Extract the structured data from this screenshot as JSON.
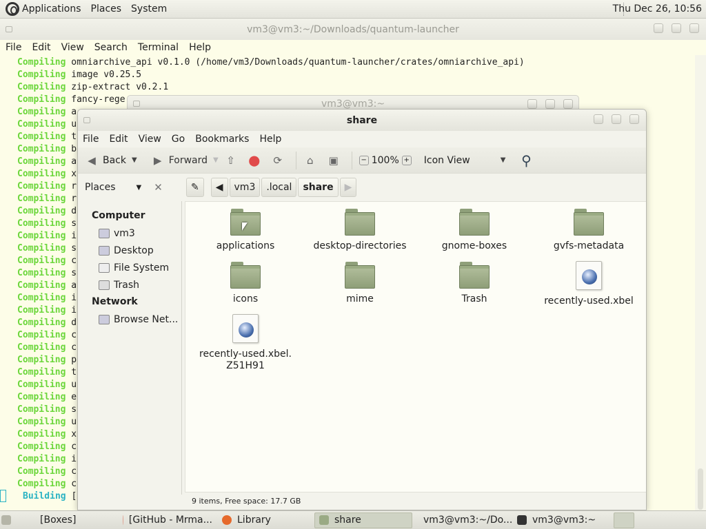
{
  "top_panel": {
    "menus": [
      "Applications",
      "Places",
      "System"
    ],
    "clock": "Thu Dec 26, 10:56"
  },
  "terminal": {
    "title": "vm3@vm3:~/Downloads/quantum-launcher",
    "menus": [
      "File",
      "Edit",
      "View",
      "Search",
      "Terminal",
      "Help"
    ],
    "lines": [
      {
        "kw": "Compiling",
        "text": "omniarchive_api v0.1.0 (/home/vm3/Downloads/quantum-launcher/crates/omniarchive_api)"
      },
      {
        "kw": "Compiling",
        "text": "image v0.25.5"
      },
      {
        "kw": "Compiling",
        "text": "zip-extract v0.2.1"
      },
      {
        "kw": "Compiling",
        "text": "fancy-rege"
      },
      {
        "kw": "Compiling",
        "text": "a"
      },
      {
        "kw": "Compiling",
        "text": "u"
      },
      {
        "kw": "Compiling",
        "text": "t"
      },
      {
        "kw": "Compiling",
        "text": "b"
      },
      {
        "kw": "Compiling",
        "text": "a"
      },
      {
        "kw": "Compiling",
        "text": "x"
      },
      {
        "kw": "Compiling",
        "text": "r"
      },
      {
        "kw": "Compiling",
        "text": "r"
      },
      {
        "kw": "Compiling",
        "text": "d"
      },
      {
        "kw": "Compiling",
        "text": "s"
      },
      {
        "kw": "Compiling",
        "text": "i"
      },
      {
        "kw": "Compiling",
        "text": "s"
      },
      {
        "kw": "Compiling",
        "text": "c"
      },
      {
        "kw": "Compiling",
        "text": "s"
      },
      {
        "kw": "Compiling",
        "text": "a"
      },
      {
        "kw": "Compiling",
        "text": "i"
      },
      {
        "kw": "Compiling",
        "text": "i"
      },
      {
        "kw": "Compiling",
        "text": "d"
      },
      {
        "kw": "Compiling",
        "text": "c"
      },
      {
        "kw": "Compiling",
        "text": "c"
      },
      {
        "kw": "Compiling",
        "text": "p"
      },
      {
        "kw": "Compiling",
        "text": "t"
      },
      {
        "kw": "Compiling",
        "text": "u"
      },
      {
        "kw": "Compiling",
        "text": "e"
      },
      {
        "kw": "Compiling",
        "text": "s"
      },
      {
        "kw": "Compiling",
        "text": "u"
      },
      {
        "kw": "Compiling",
        "text": "x"
      },
      {
        "kw": "Compiling",
        "text": "c"
      },
      {
        "kw": "Compiling",
        "text": "i"
      },
      {
        "kw": "Compiling",
        "text": "c"
      },
      {
        "kw": "Compiling",
        "text": "c"
      }
    ],
    "building": {
      "kw": "Building",
      "text": "["
    }
  },
  "bg_window": {
    "title": "vm3@vm3:~"
  },
  "file_manager": {
    "title": "share",
    "menus": [
      "File",
      "Edit",
      "View",
      "Go",
      "Bookmarks",
      "Help"
    ],
    "toolbar": {
      "back": "Back",
      "forward": "Forward",
      "zoom": "100%",
      "view_mode": "Icon View"
    },
    "sidebar_title": "Places",
    "path": [
      "vm3",
      ".local",
      "share"
    ],
    "sidebar": {
      "computer_heading": "Computer",
      "computer_items": [
        "vm3",
        "Desktop",
        "File System",
        "Trash"
      ],
      "network_heading": "Network",
      "network_items": [
        "Browse Net..."
      ]
    },
    "items": [
      {
        "name": "applications",
        "type": "folder"
      },
      {
        "name": "desktop-directories",
        "type": "folder"
      },
      {
        "name": "gnome-boxes",
        "type": "folder"
      },
      {
        "name": "gvfs-metadata",
        "type": "folder"
      },
      {
        "name": "icons",
        "type": "folder"
      },
      {
        "name": "mime",
        "type": "folder"
      },
      {
        "name": "Trash",
        "type": "folder"
      },
      {
        "name": "recently-used.xbel",
        "type": "file"
      },
      {
        "name": "recently-used.xbel.",
        "name2": "Z51H91",
        "type": "file"
      }
    ],
    "status": "9 items, Free space: 17.7 GB"
  },
  "taskbar": {
    "tasks": [
      "[Boxes]",
      "[GitHub - Mrma...",
      "Library",
      "share",
      "vm3@vm3:~/Do...",
      "vm3@vm3:~"
    ]
  }
}
